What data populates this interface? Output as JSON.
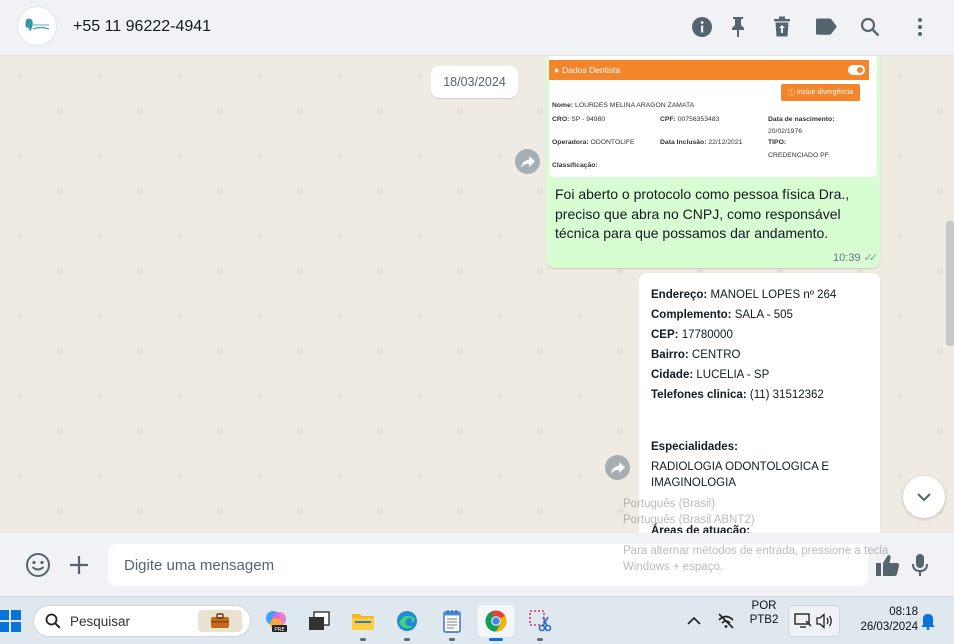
{
  "header": {
    "contact": "+55 11 96222-4941",
    "icons": [
      "info-icon",
      "pin-icon",
      "delete-icon",
      "label-icon",
      "search-icon",
      "menu-icon"
    ]
  },
  "chat": {
    "date_chip": "18/03/2024",
    "outgoing": {
      "image": {
        "bar_title": "Dados Dentista",
        "button": "Incluir divergência",
        "nome_label": "Nome:",
        "nome": "LOURDES MELINA ARAGON ZAMATA",
        "cro_label": "CRO:",
        "cro": "SP - 94980",
        "cpf_label": "CPF:",
        "cpf": "00756353483",
        "nasc_label": "Data de nascimento:",
        "nasc": "20/02/1976",
        "operadora_label": "Operadora:",
        "operadora": "ODONTOLIFE",
        "inclusao_label": "Data Inclusão:",
        "inclusao": "22/12/2021",
        "tipo_label": "TIPO:",
        "tipo": "CREDENCIADO PF",
        "classificacao_label": "Classificação:"
      },
      "text_lines": [
        "Foi aberto o protocolo como pessoa física Dra.,",
        "preciso que abra no CNPJ, como responsável",
        "técnica para que possamos dar andamento."
      ],
      "time": "10:39",
      "ticks": "✓✓"
    },
    "incoming": {
      "endereco_label": "Endereço:",
      "endereco": "MANOEL LOPES nº 264",
      "complemento_label": "Complemento:",
      "complemento": "SALA - 505",
      "cep_label": "CEP:",
      "cep": "17780000",
      "bairro_label": "Bairro:",
      "bairro": "CENTRO",
      "cidade_label": "Cidade:",
      "cidade": "LUCELIA - SP",
      "telefones_label": "Telefones clinica:",
      "telefones": "(11) 31512362",
      "especialidades_label": "Especialidades:",
      "especialidades_line1": "RADIOLOGIA ODONTOLOGICA E",
      "especialidades_line2": "IMAGINOLOGIA",
      "areas_label": "Áreas de atuação:"
    },
    "ime_overlay": {
      "line1": "Português (Brasil)",
      "line2": "Português (Brasil ABNT2)",
      "line3": "Para alternar métodos de entrada, pressione a tecla",
      "line4": "Windows + espaço."
    }
  },
  "composer": {
    "placeholder": "Digite uma mensagem"
  },
  "taskbar": {
    "search_label": "Pesquisar",
    "lang_top": "POR",
    "lang_bottom": "PTB2",
    "time": "08:18",
    "date": "26/03/2024"
  },
  "colors": {
    "outgoing_bubble": "#d9fdd3",
    "accent_orange": "#f5852b",
    "chat_bg": "#efeae2",
    "header_bg": "#f0f2f5"
  }
}
